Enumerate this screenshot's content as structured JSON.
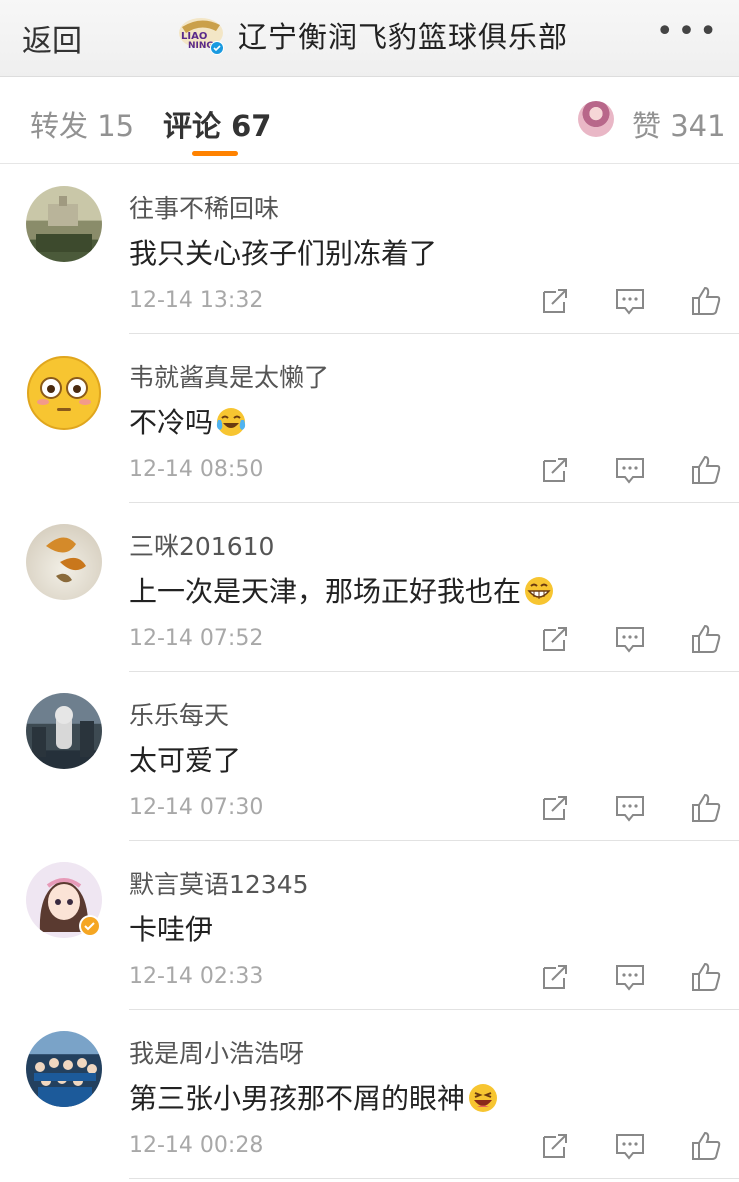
{
  "header": {
    "back_label": "返回",
    "logo_text": "LIAONING",
    "title": "辽宁衡润飞豹篮球俱乐部",
    "more_label": "•••"
  },
  "tabs": {
    "repost_label": "转发 15",
    "comment_label": "评论 67",
    "like_label": "赞 341",
    "active": "comment",
    "accent_color": "#ff8200"
  },
  "comments": [
    {
      "user": "往事不稀回味",
      "text": "我只关心孩子们别冻着了",
      "time": "12-14 13:32",
      "avatar": "building-photo",
      "emoji": ""
    },
    {
      "user": "韦就酱真是太懒了",
      "text": "不冷吗",
      "time": "12-14 08:50",
      "avatar": "flushed-face-emoji",
      "emoji": "laugh-cry"
    },
    {
      "user": "三咪201610",
      "text": "上一次是天津，那场正好我也在",
      "time": "12-14 07:52",
      "avatar": "leaf-photo",
      "emoji": "grin"
    },
    {
      "user": "乐乐每天",
      "text": "太可爱了",
      "time": "12-14 07:30",
      "avatar": "merlion-photo",
      "emoji": ""
    },
    {
      "user": "默言莫语12345",
      "text": "卡哇伊",
      "time": "12-14 02:33",
      "avatar": "anime-girl-verified",
      "emoji": ""
    },
    {
      "user": "我是周小浩浩呀",
      "text": "第三张小男孩那不屑的眼神",
      "time": "12-14 00:28",
      "avatar": "group-photo",
      "emoji": "laugh"
    }
  ],
  "actions": [
    "share-icon",
    "comment-icon",
    "thumbs-up-icon"
  ]
}
